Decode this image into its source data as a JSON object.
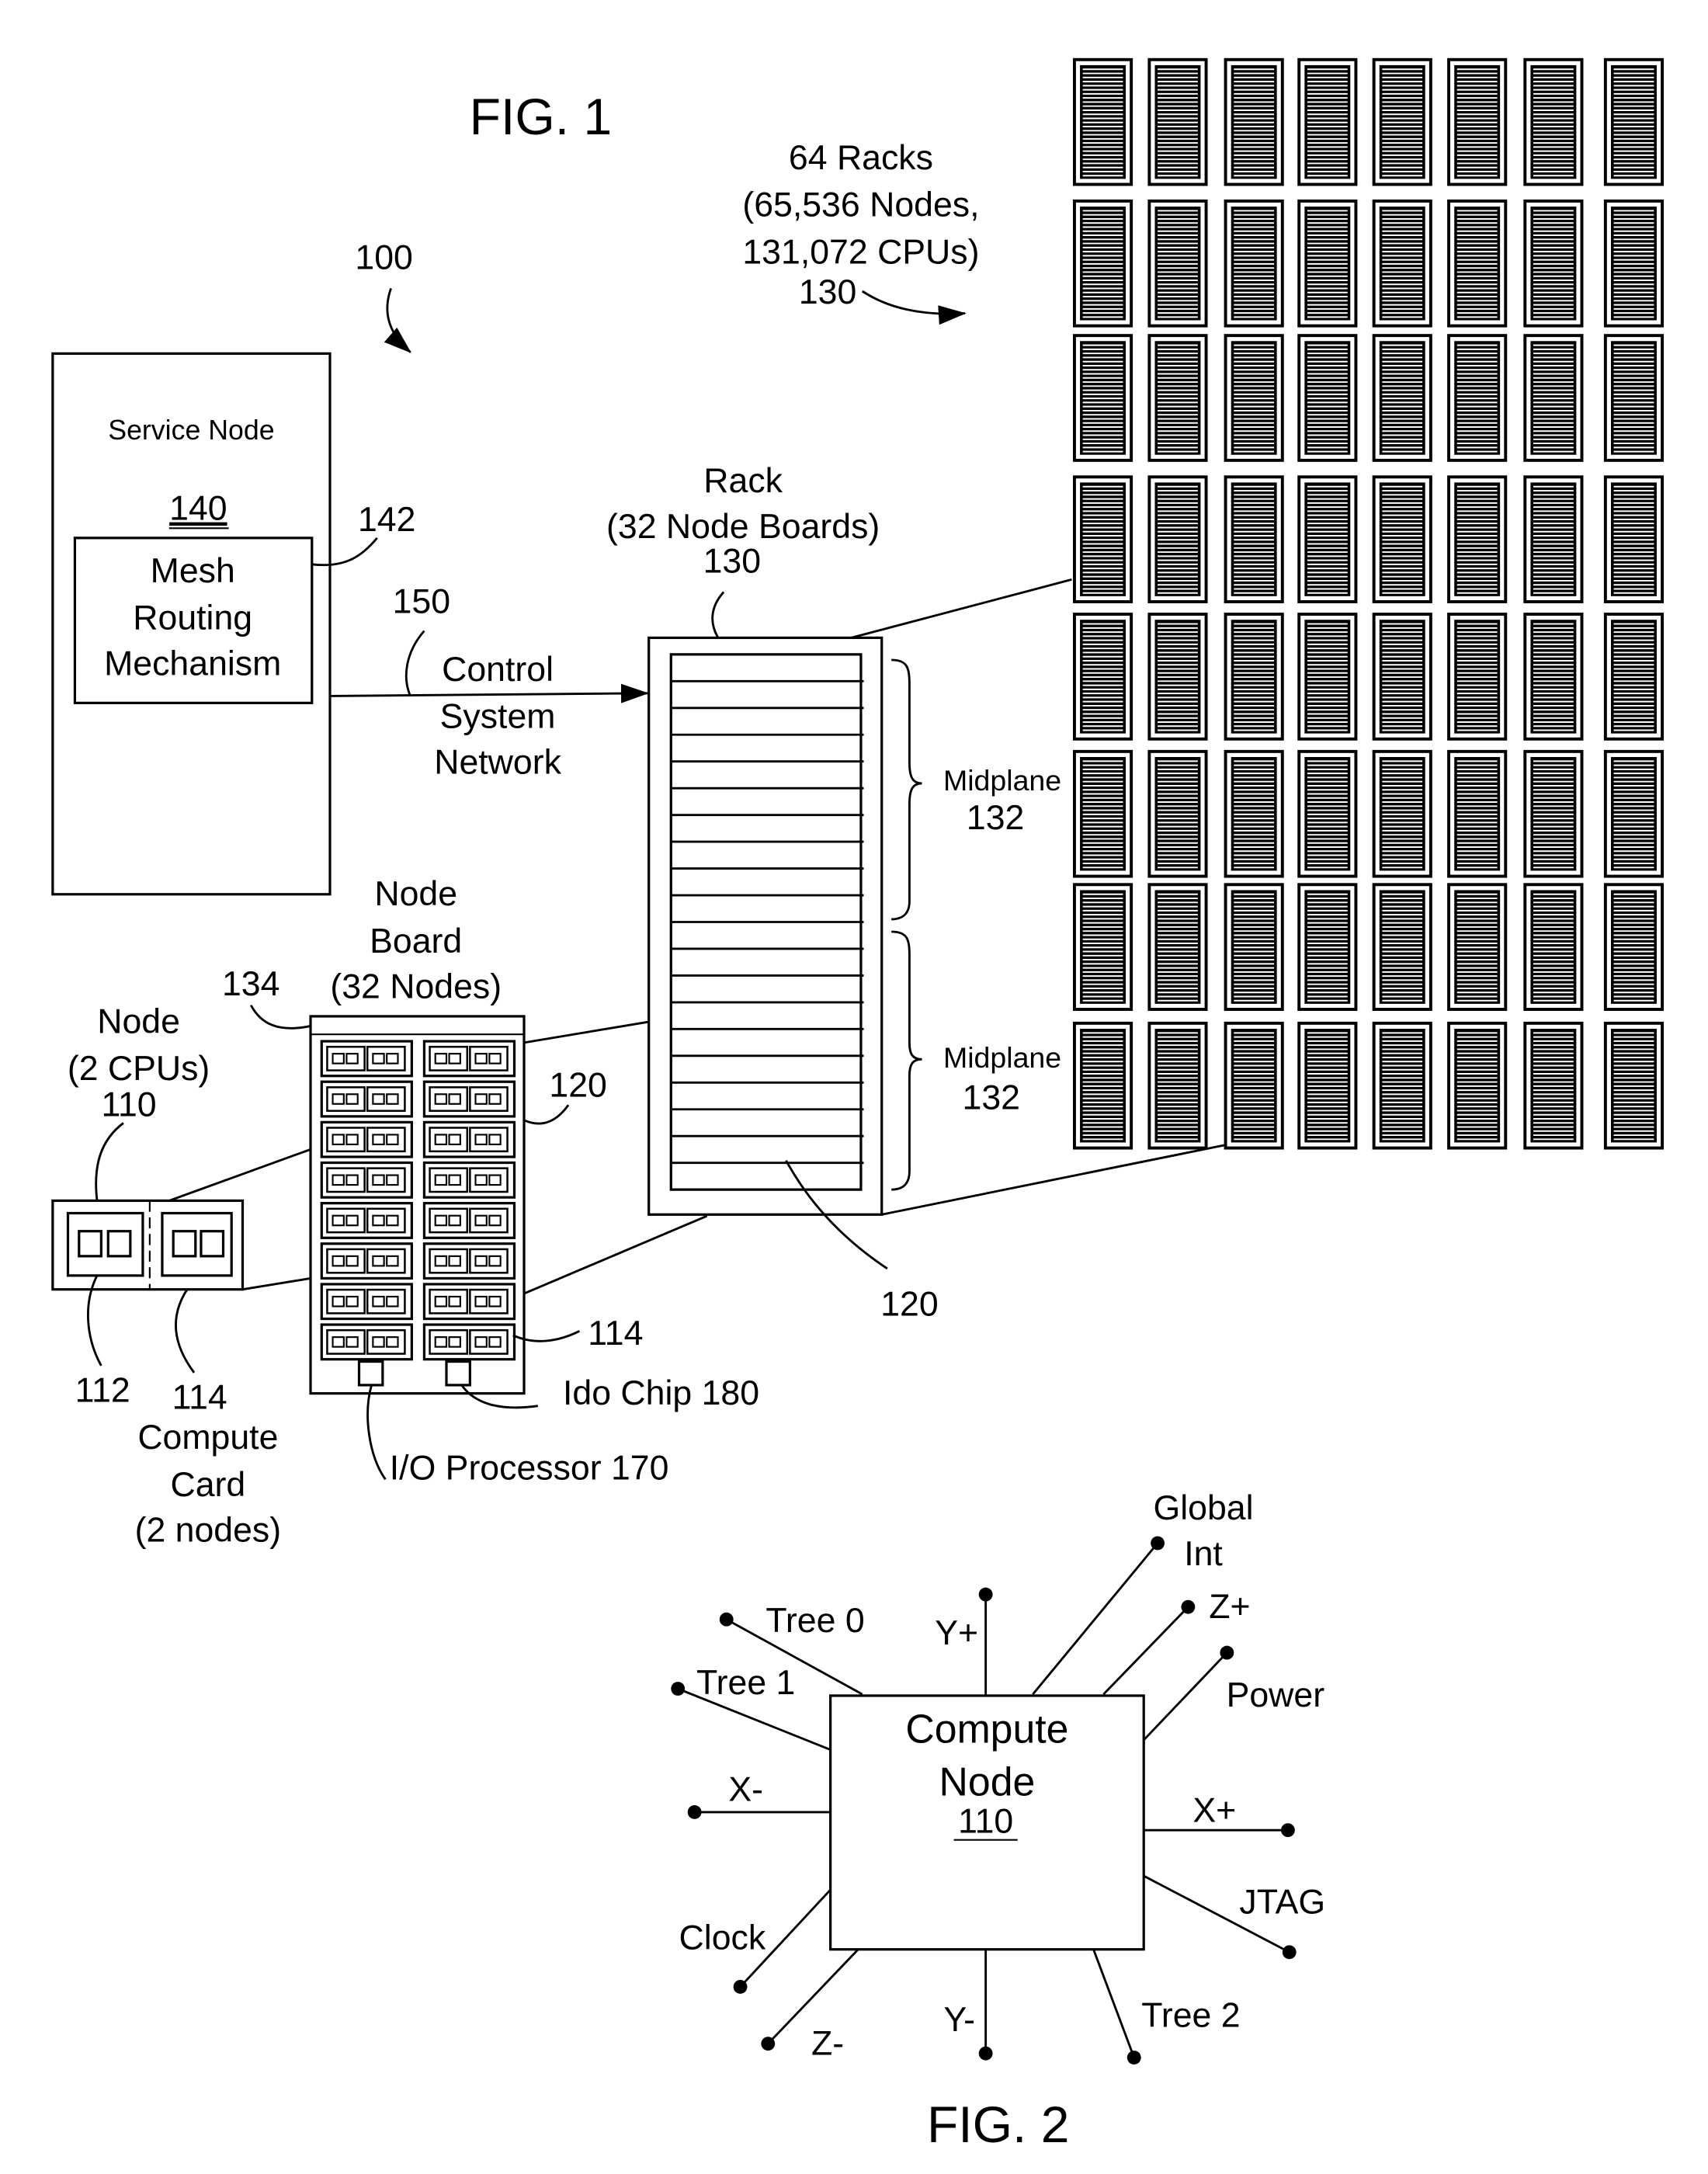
{
  "fig1": {
    "title": "FIG. 1",
    "system_ref": "100",
    "racks_label": {
      "line1": "64 Racks",
      "line2": "(65,536 Nodes,",
      "line3": "131,072 CPUs)",
      "ref": "130",
      "rows": 8,
      "cols": 8
    },
    "service_node": {
      "label": "Service Node",
      "ref": "140",
      "mesh": {
        "line1": "Mesh",
        "line2": "Routing",
        "line3": "Mechanism",
        "ref": "142"
      }
    },
    "control_network": {
      "ref": "150",
      "line1": "Control",
      "line2": "System",
      "line3": "Network"
    },
    "rack": {
      "line1": "Rack",
      "line2": "(32 Node Boards)",
      "ref": "130",
      "board_ref": "120",
      "board_count": 32,
      "midplanes": [
        {
          "label": "Midplane",
          "ref": "132"
        },
        {
          "label": "Midplane",
          "ref": "132"
        }
      ]
    },
    "node_board": {
      "line1": "Node",
      "line2": "Board",
      "line3": "(32 Nodes)",
      "ref": "134",
      "board_ref": "120",
      "card_ref": "114",
      "card_rows": 8,
      "card_cols": 2,
      "io_processor": "I/O Processor 170",
      "ido_chip": "Ido Chip 180"
    },
    "node": {
      "line1": "Node",
      "line2": "(2 CPUs)",
      "ref": "110"
    },
    "compute_card": {
      "chip_ref": "112",
      "card_ref": "114",
      "line1": "Compute",
      "line2": "Card",
      "line3": "(2 nodes)"
    }
  },
  "fig2": {
    "title": "FIG. 2",
    "node": {
      "line1": "Compute",
      "line2": "Node",
      "ref": "110"
    },
    "connections": [
      {
        "id": "tree0",
        "label": "Tree 0"
      },
      {
        "id": "tree1",
        "label": "Tree 1"
      },
      {
        "id": "xminus",
        "label": "X-"
      },
      {
        "id": "clock",
        "label": "Clock"
      },
      {
        "id": "zminus",
        "label": "Z-"
      },
      {
        "id": "yminus",
        "label": "Y-"
      },
      {
        "id": "tree2",
        "label": "Tree 2"
      },
      {
        "id": "jtag",
        "label": "JTAG"
      },
      {
        "id": "xplus",
        "label": "X+"
      },
      {
        "id": "power",
        "label": "Power"
      },
      {
        "id": "zplus",
        "label": "Z+"
      },
      {
        "id": "global1",
        "label": "Global"
      },
      {
        "id": "global2",
        "label": "Int"
      },
      {
        "id": "yplus",
        "label": "Y+"
      }
    ]
  }
}
